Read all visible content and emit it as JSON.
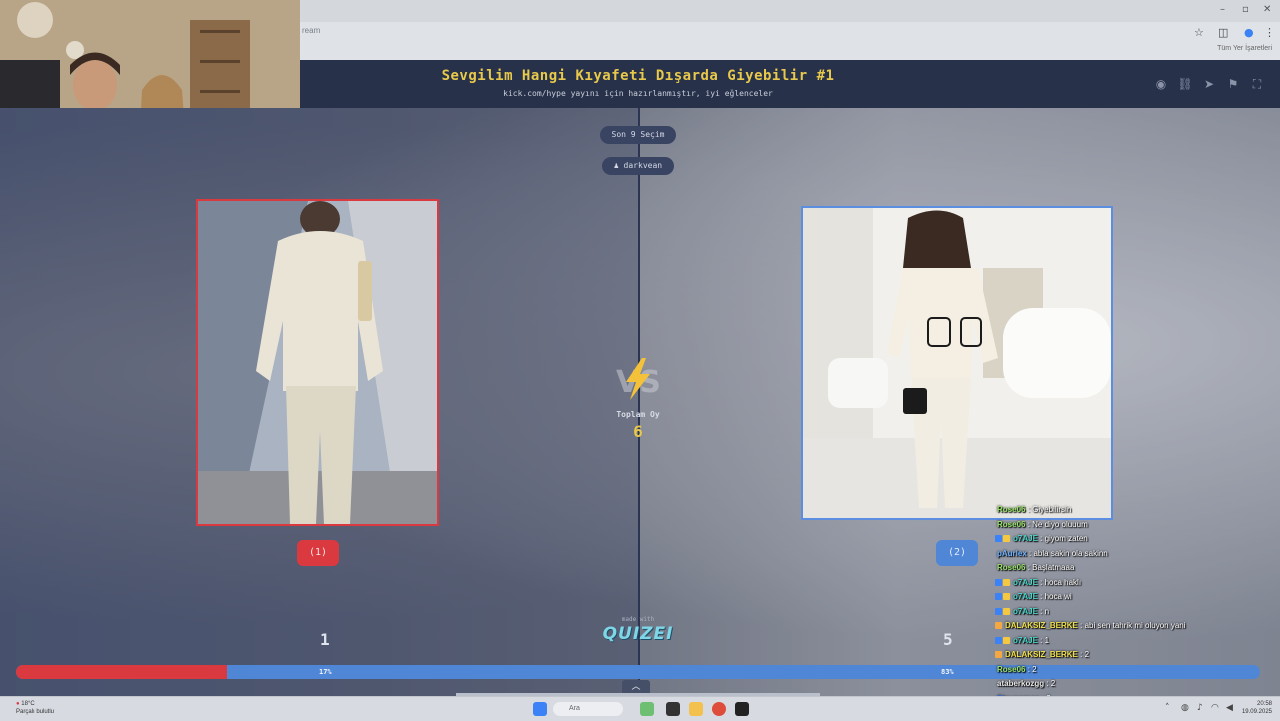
{
  "browser": {
    "url_fragment": "ream",
    "bookmark_label": "Tüm Yer İşaretleri"
  },
  "header": {
    "title": "Sevgilim Hangi Kıyafeti Dışarda Giyebilir #1",
    "subtitle": "kick.com/hype yayını için hazırlanmıştır, iyi eğlenceler"
  },
  "center": {
    "last_selection": "Son 9 Seçim",
    "user_pill": "darkvean",
    "total_label": "Toplam Oy",
    "total_value": "6",
    "made_with": "made with",
    "logo": "QUIZEI"
  },
  "options": [
    {
      "vote_label": "(1)",
      "count": "1",
      "percent": "17%",
      "border_color": "#d9393f"
    },
    {
      "vote_label": "(2)",
      "count": "5",
      "percent": "83%",
      "border_color": "#5b8de0"
    }
  ],
  "vote_share_left": 0.17,
  "chat": [
    {
      "user": "Rose06",
      "msg": "Giyebilirsin",
      "color": "#9be36d",
      "badges": []
    },
    {
      "user": "Rose06",
      "msg": "Ne diyo oluuum",
      "color": "#9be36d",
      "badges": []
    },
    {
      "user": "o7AJE",
      "msg": "giyom zaten",
      "color": "#47d6c9",
      "badges": [
        "#3b82f6",
        "#f5c842"
      ]
    },
    {
      "user": "pAurlex",
      "msg": "abla sakin ola sakinn",
      "color": "#6fb3ff",
      "badges": []
    },
    {
      "user": "Rose06",
      "msg": "Başlatmaaa",
      "color": "#9be36d",
      "badges": []
    },
    {
      "user": "o7AJE",
      "msg": "hoca haklı",
      "color": "#47d6c9",
      "badges": [
        "#3b82f6",
        "#f5c842"
      ]
    },
    {
      "user": "o7AJE",
      "msg": "hoca wi",
      "color": "#47d6c9",
      "badges": [
        "#3b82f6",
        "#f5c842"
      ]
    },
    {
      "user": "o7AJE",
      "msg": "n",
      "color": "#47d6c9",
      "badges": [
        "#3b82f6",
        "#f5c842"
      ]
    },
    {
      "user": "DALAKSIZ_BERKE",
      "msg": "abi sen tahrik mi oluyon yani",
      "color": "#f0e04a",
      "badges": [
        "#f5a742"
      ]
    },
    {
      "user": "o7AJE",
      "msg": "1",
      "color": "#47d6c9",
      "badges": [
        "#3b82f6",
        "#f5c842"
      ]
    },
    {
      "user": "DALAKSIZ_BERKE",
      "msg": "2",
      "color": "#f0e04a",
      "badges": [
        "#f5a742"
      ]
    },
    {
      "user": "Rose06",
      "msg": "2",
      "color": "#9be36d",
      "badges": []
    },
    {
      "user": "ataberkozgg",
      "msg": "2",
      "color": "#e6e6e6",
      "badges": []
    },
    {
      "user": "Sinyonmas",
      "msg": "2",
      "color": "#3b6fd6",
      "badges": []
    },
    {
      "user": "pAurlex",
      "msg": "2",
      "color": "#6fb3ff",
      "badges": []
    }
  ],
  "taskbar": {
    "weather_temp": "18°C",
    "weather_desc": "Parçalı bulutlu",
    "search": "Ara",
    "time": "20:58",
    "date": "19.09.2025"
  },
  "colors": {
    "accent_red": "#d9393f",
    "accent_blue": "#4f86d6",
    "title_gold": "#e8c94a"
  }
}
